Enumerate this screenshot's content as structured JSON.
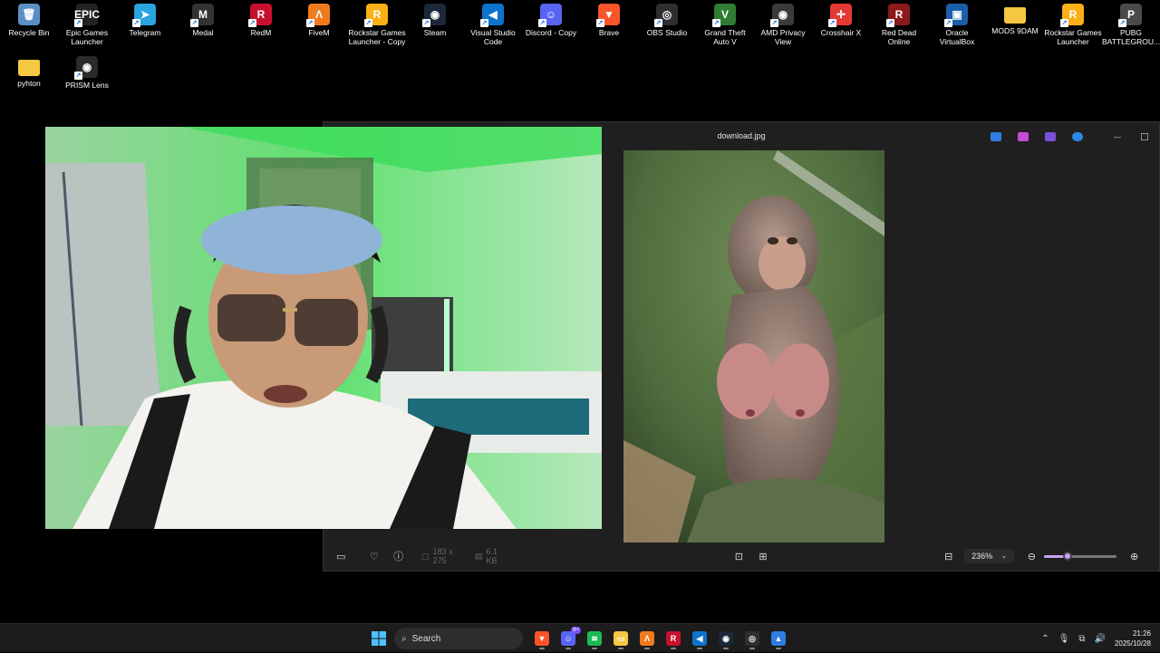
{
  "desktop": {
    "icons_row1": [
      {
        "label": "Recycle Bin",
        "icon": "recycle-bin-icon",
        "color": "#5a8fc4",
        "glyph": "🗑",
        "shortcut": false
      },
      {
        "label": "Epic Games Launcher",
        "icon": "epic-games-icon",
        "color": "#222222",
        "glyph": "EPIC",
        "shortcut": true
      },
      {
        "label": "Telegram",
        "icon": "telegram-icon",
        "color": "#2aa3de",
        "glyph": "➤",
        "shortcut": true
      },
      {
        "label": "Medal",
        "icon": "medal-icon",
        "color": "#333333",
        "glyph": "M",
        "shortcut": true
      },
      {
        "label": "RedM",
        "icon": "redm-icon",
        "color": "#c8102e",
        "glyph": "R",
        "shortcut": true
      },
      {
        "label": "FiveM",
        "icon": "fivem-icon",
        "color": "#f07b1e",
        "glyph": "Λ",
        "shortcut": true
      },
      {
        "label": "Rockstar Games Launcher - Copy",
        "icon": "rockstar-icon",
        "color": "#fcaf17",
        "glyph": "R",
        "shortcut": true
      },
      {
        "label": "Steam",
        "icon": "steam-icon",
        "color": "#1b2838",
        "glyph": "◉",
        "shortcut": true
      },
      {
        "label": "Visual Studio Code",
        "icon": "vscode-icon",
        "color": "#0e73cc",
        "glyph": "◀",
        "shortcut": true
      },
      {
        "label": "Discord - Copy",
        "icon": "discord-icon",
        "color": "#5865f2",
        "glyph": "☺",
        "shortcut": true
      },
      {
        "label": "Brave",
        "icon": "brave-icon",
        "color": "#fb542b",
        "glyph": "▼",
        "shortcut": true
      },
      {
        "label": "OBS Studio",
        "icon": "obs-icon",
        "color": "#302e31",
        "glyph": "◎",
        "shortcut": true
      },
      {
        "label": "Grand Theft Auto V",
        "icon": "gta-icon",
        "color": "#2e7d32",
        "glyph": "V",
        "shortcut": true
      },
      {
        "label": "AMD Privacy View",
        "icon": "amd-privacy-icon",
        "color": "#3a3a3a",
        "glyph": "◉",
        "shortcut": true
      },
      {
        "label": "Crosshair X",
        "icon": "crosshair-icon",
        "color": "#e53935",
        "glyph": "✛",
        "shortcut": true
      },
      {
        "label": "Red Dead Online",
        "icon": "red-dead-icon",
        "color": "#8b1a1a",
        "glyph": "R",
        "shortcut": true
      },
      {
        "label": "Oracle VirtualBox",
        "icon": "virtualbox-icon",
        "color": "#1a5fa8",
        "glyph": "▣",
        "shortcut": true
      },
      {
        "label": "MODS 9DAM",
        "icon": "folder-icon",
        "color": "#f4c842",
        "glyph": "",
        "shortcut": false
      },
      {
        "label": "Rockstar Games Launcher",
        "icon": "rockstar-icon",
        "color": "#fcaf17",
        "glyph": "R",
        "shortcut": true
      },
      {
        "label": "PUBG BATTLEGROU...",
        "icon": "pubg-icon",
        "color": "#4a4a4a",
        "glyph": "P",
        "shortcut": true
      }
    ],
    "icons_row2": [
      {
        "label": "pyhton",
        "icon": "folder-icon",
        "color": "#f4c842",
        "glyph": "",
        "shortcut": false
      },
      {
        "label": "PRISM Lens",
        "icon": "prism-lens-icon",
        "color": "#2a2a2a",
        "glyph": "◉",
        "shortcut": true
      }
    ]
  },
  "photos": {
    "title": "download.jpg",
    "titlebar_icons": [
      {
        "name": "edit-app-icon",
        "color": "#2f7de1"
      },
      {
        "name": "copilot-icon",
        "color": "#c84bd6"
      },
      {
        "name": "clipchamp-icon",
        "color": "#7b4fd8"
      },
      {
        "name": "onedrive-icon",
        "color": "#2a8ae6"
      }
    ],
    "minimize_glyph": "—",
    "maximize_glyph": "☐",
    "image_size": "183 x 275",
    "file_size": "6.1 KB",
    "zoom": "236%",
    "zoom_fraction": 0.33
  },
  "taskbar": {
    "search_placeholder": "Search",
    "discord_badge": "9+",
    "apps": [
      {
        "name": "brave-taskbar-icon",
        "color": "#fb542b",
        "glyph": "▼"
      },
      {
        "name": "discord-taskbar-icon",
        "color": "#5865f2",
        "glyph": "☺",
        "badge": true
      },
      {
        "name": "spotify-taskbar-icon",
        "color": "#1db954",
        "glyph": "≋"
      },
      {
        "name": "file-explorer-taskbar-icon",
        "color": "#f4c842",
        "glyph": "▭"
      },
      {
        "name": "fivem-taskbar-icon",
        "color": "#f07b1e",
        "glyph": "Λ"
      },
      {
        "name": "redm-taskbar-icon",
        "color": "#c8102e",
        "glyph": "R"
      },
      {
        "name": "vscode-taskbar-icon",
        "color": "#0e73cc",
        "glyph": "◀"
      },
      {
        "name": "steam-taskbar-icon",
        "color": "#1b2838",
        "glyph": "◉"
      },
      {
        "name": "obs-taskbar-icon",
        "color": "#302e31",
        "glyph": "◎"
      },
      {
        "name": "photos-taskbar-icon",
        "color": "#2f7de1",
        "glyph": "▲"
      }
    ],
    "time": "21:26",
    "date": "2025/10/28"
  }
}
